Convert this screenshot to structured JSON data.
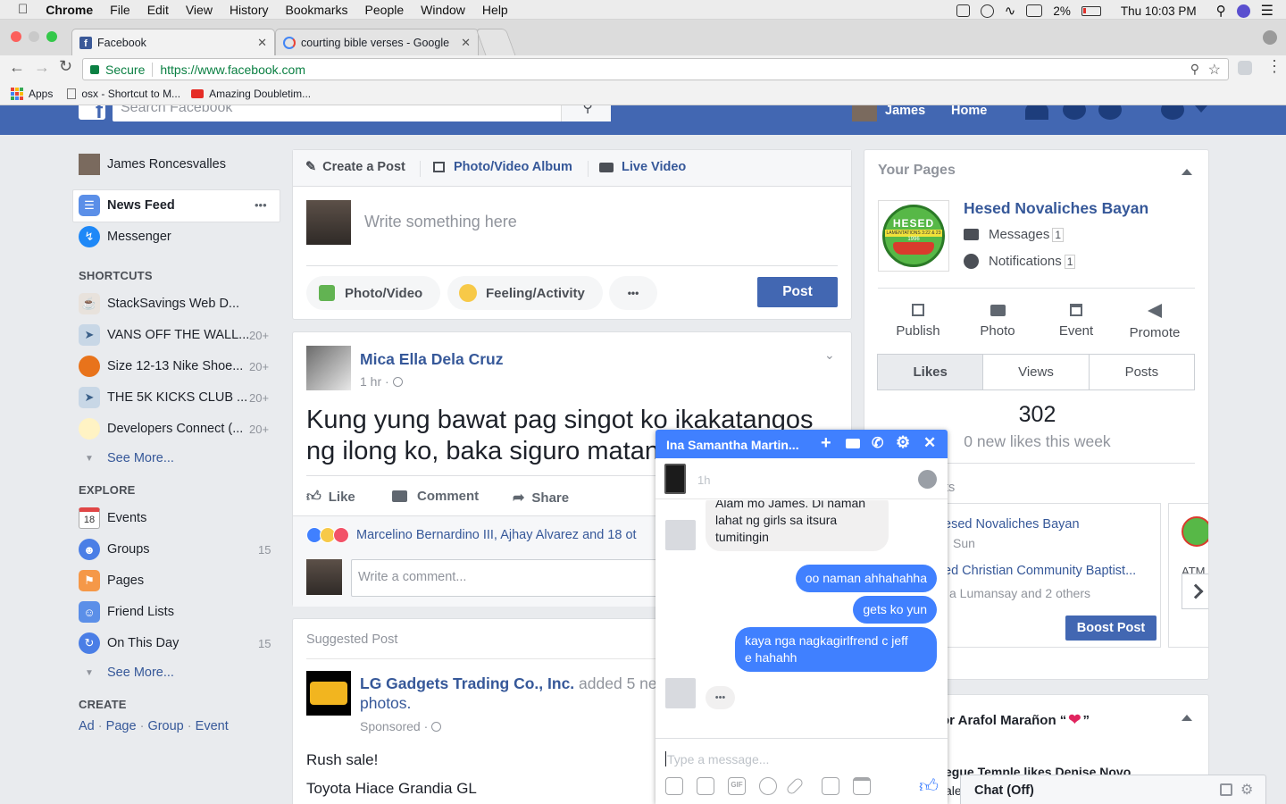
{
  "mac_menu": {
    "app": "Chrome",
    "items": [
      "File",
      "Edit",
      "View",
      "History",
      "Bookmarks",
      "People",
      "Window",
      "Help"
    ],
    "battery": "2%",
    "clock": "Thu 10:03 PM"
  },
  "browser": {
    "tabs": [
      {
        "title": "Facebook"
      },
      {
        "title": "courting bible verses - Google"
      }
    ],
    "secure_label": "Secure",
    "url": "https://www.facebook.com",
    "bookmarks": [
      "Apps",
      "osx - Shortcut to M...",
      "Amazing Doubletim..."
    ]
  },
  "fb_header": {
    "search_placeholder": "Search Facebook",
    "user": "James",
    "home": "Home"
  },
  "left_nav": {
    "profile": "James Roncesvalles",
    "news_feed": "News Feed",
    "messenger": "Messenger",
    "shortcuts_title": "SHORTCUTS",
    "shortcuts": [
      {
        "label": "StackSavings Web D...",
        "count": ""
      },
      {
        "label": "VANS OFF THE WALL...",
        "count": "20+"
      },
      {
        "label": "Size 12-13 Nike Shoe...",
        "count": "20+"
      },
      {
        "label": "THE 5K KICKS CLUB ...",
        "count": "20+"
      },
      {
        "label": "Developers Connect (...",
        "count": "20+"
      }
    ],
    "see_more": "See More...",
    "explore_title": "EXPLORE",
    "explore": [
      {
        "label": "Events",
        "count": ""
      },
      {
        "label": "Groups",
        "count": "15"
      },
      {
        "label": "Pages",
        "count": ""
      },
      {
        "label": "Friend Lists",
        "count": ""
      },
      {
        "label": "On This Day",
        "count": "15"
      }
    ],
    "events_day": "18",
    "create_title": "CREATE",
    "create_links": [
      "Ad",
      "Page",
      "Group",
      "Event"
    ],
    "separator": "·"
  },
  "composer": {
    "tabs": [
      "Create a Post",
      "Photo/Video Album",
      "Live Video"
    ],
    "placeholder": "Write something here",
    "actions": [
      "Photo/Video",
      "Feeling/Activity"
    ],
    "more": "•••",
    "post_button": "Post"
  },
  "post": {
    "author": "Mica Ella Dela Cruz",
    "time": "1 hr ·",
    "text_line1": "Kung yung bawat pag singot ko ikakatangos",
    "text_line2": "ng ilong ko, baka siguro matang",
    "actions": [
      "Like",
      "Comment",
      "Share"
    ],
    "reactions": "Marcelino Bernardino III, Ajhay Alvarez and 18 ot",
    "comment_placeholder": "Write a comment..."
  },
  "suggested": {
    "label": "Suggested Post",
    "company": "LG Gadgets Trading Co., Inc.",
    "added": "added 5 ne",
    "photos": "photos.",
    "sponsored": "Sponsored ·",
    "line1": "Rush sale!",
    "line2": "Toyota Hiace Grandia GL"
  },
  "your_pages": {
    "title": "Your Pages",
    "page_name": "Hesed Novaliches Bayan",
    "messages": "Messages",
    "messages_count": "1",
    "notifications": "Notifications",
    "notifications_count": "1",
    "logo_text": "HESED",
    "logo_sub": "LAMENTATIONS 3:22 & 23",
    "logo_year": "1996",
    "actions": [
      "Publish",
      "Photo",
      "Event",
      "Promote"
    ],
    "stat_tabs": [
      "Likes",
      "Views",
      "Posts"
    ],
    "likes_value": "302",
    "likes_sub": "0 new likes this week",
    "posts_label": "ts",
    "post1_title": "esed Novaliches Bayan",
    "post1_sub": "Sun",
    "post2_title": "ed Christian Community Baptist...",
    "post2_sub": "a Lumansay and 2 others",
    "boost": "Boost Post",
    "atm": "ATM"
  },
  "birthday_card": {
    "title": "or Arafol Marañon “",
    "title_end": "”",
    "snippet": "egue Temple likes Denise Novo",
    "snippet2": "ale"
  },
  "chat_bar": {
    "label": "Chat (Off)"
  },
  "chat": {
    "name": "Ina Samantha Martin...",
    "time": "1h",
    "incoming": [
      "Alam mo James. Di naman",
      "lahat ng girls sa itsura",
      "tumitingin"
    ],
    "outgoing": [
      "oo naman ahhahahha",
      "gets ko yun"
    ],
    "outgoing3_l1": "kaya nga nagkagirlfrend c jeff",
    "outgoing3_l2": "e hahahh",
    "typing": "•••",
    "input_placeholder": "Type a message...",
    "gif": "GIF"
  },
  "colors": {
    "fb_blue": "#4267b2",
    "link": "#365899",
    "messenger_blue": "#4080ff"
  }
}
